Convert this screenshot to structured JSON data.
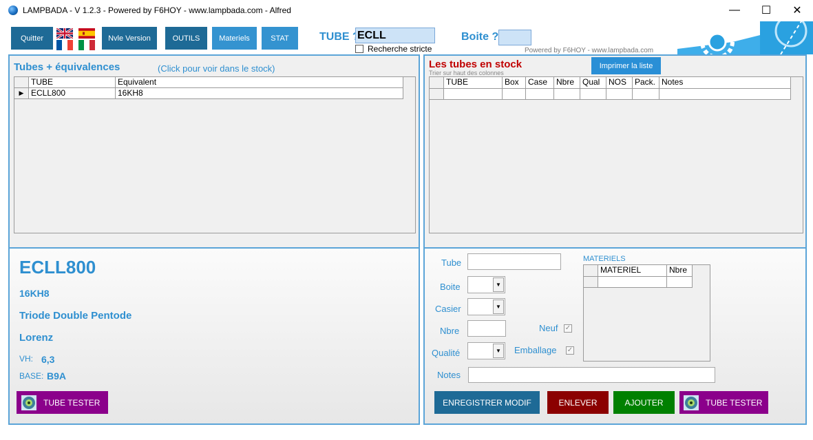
{
  "window": {
    "title": "LAMPBADA - V 1.2.3 - Powered by F6HOY - www.lampbada.com - Alfred",
    "minimize_glyph": "—",
    "maximize_glyph": "☐",
    "close_glyph": "✕"
  },
  "toolbar": {
    "quit_label": "Quitter",
    "new_version_label": "Nvle Version",
    "tools_label": "OUTILS",
    "materials_label": "Materiels",
    "stat_label": "STAT",
    "tube_label": "TUBE ?",
    "tube_value": "ECLL",
    "strict_label": "Recherche stricte",
    "boite_label": "Boite ?",
    "boite_value": "",
    "powered_text": "Powered by F6HOY - www.lampbada.com"
  },
  "equivalences": {
    "title": "Tubes + équivalences",
    "hint": "(Click pour voir dans le stock)",
    "columns": [
      "TUBE",
      "Equivalent"
    ],
    "rows": [
      [
        "ECLL800",
        "16KH8"
      ]
    ]
  },
  "stock": {
    "title": "Les tubes en stock",
    "sort_hint": "Trier sur haut des colonnes",
    "print_label": "Imprimer la liste",
    "columns": [
      "TUBE",
      "Box",
      "Case",
      "Nbre",
      "Qual",
      "NOS",
      "Pack.",
      "Notes"
    ]
  },
  "details": {
    "name": "ECLL800",
    "equivalent": "16KH8",
    "type": "Triode Double Pentode",
    "brand": "Lorenz",
    "vh_label": "VH:",
    "vh_value": "6,3",
    "base_label": "BASE:",
    "base_value": "B9A",
    "tester_label": "TUBE TESTER"
  },
  "form": {
    "tube_label": "Tube",
    "boite_label": "Boite",
    "casier_label": "Casier",
    "nbre_label": "Nbre",
    "qualite_label": "Qualité",
    "notes_label": "Notes",
    "neuf_label": "Neuf",
    "emballage_label": "Emballage",
    "check_glyph": "✓",
    "materiels_title": "MATERIELS",
    "materiels_columns": [
      "MATERIEL",
      "Nbre"
    ],
    "save_label": "ENREGISTRER MODIF",
    "remove_label": "ENLEVER",
    "add_label": "AJOUTER",
    "tester_label": "TUBE TESTER"
  },
  "colors": {
    "accent": "#2e8fd0",
    "button_dark": "#1e6a96",
    "button_light": "#3493d0",
    "stock_title": "#c00000",
    "remove": "#8b0000",
    "add": "#008000",
    "tester": "#8b008b"
  }
}
